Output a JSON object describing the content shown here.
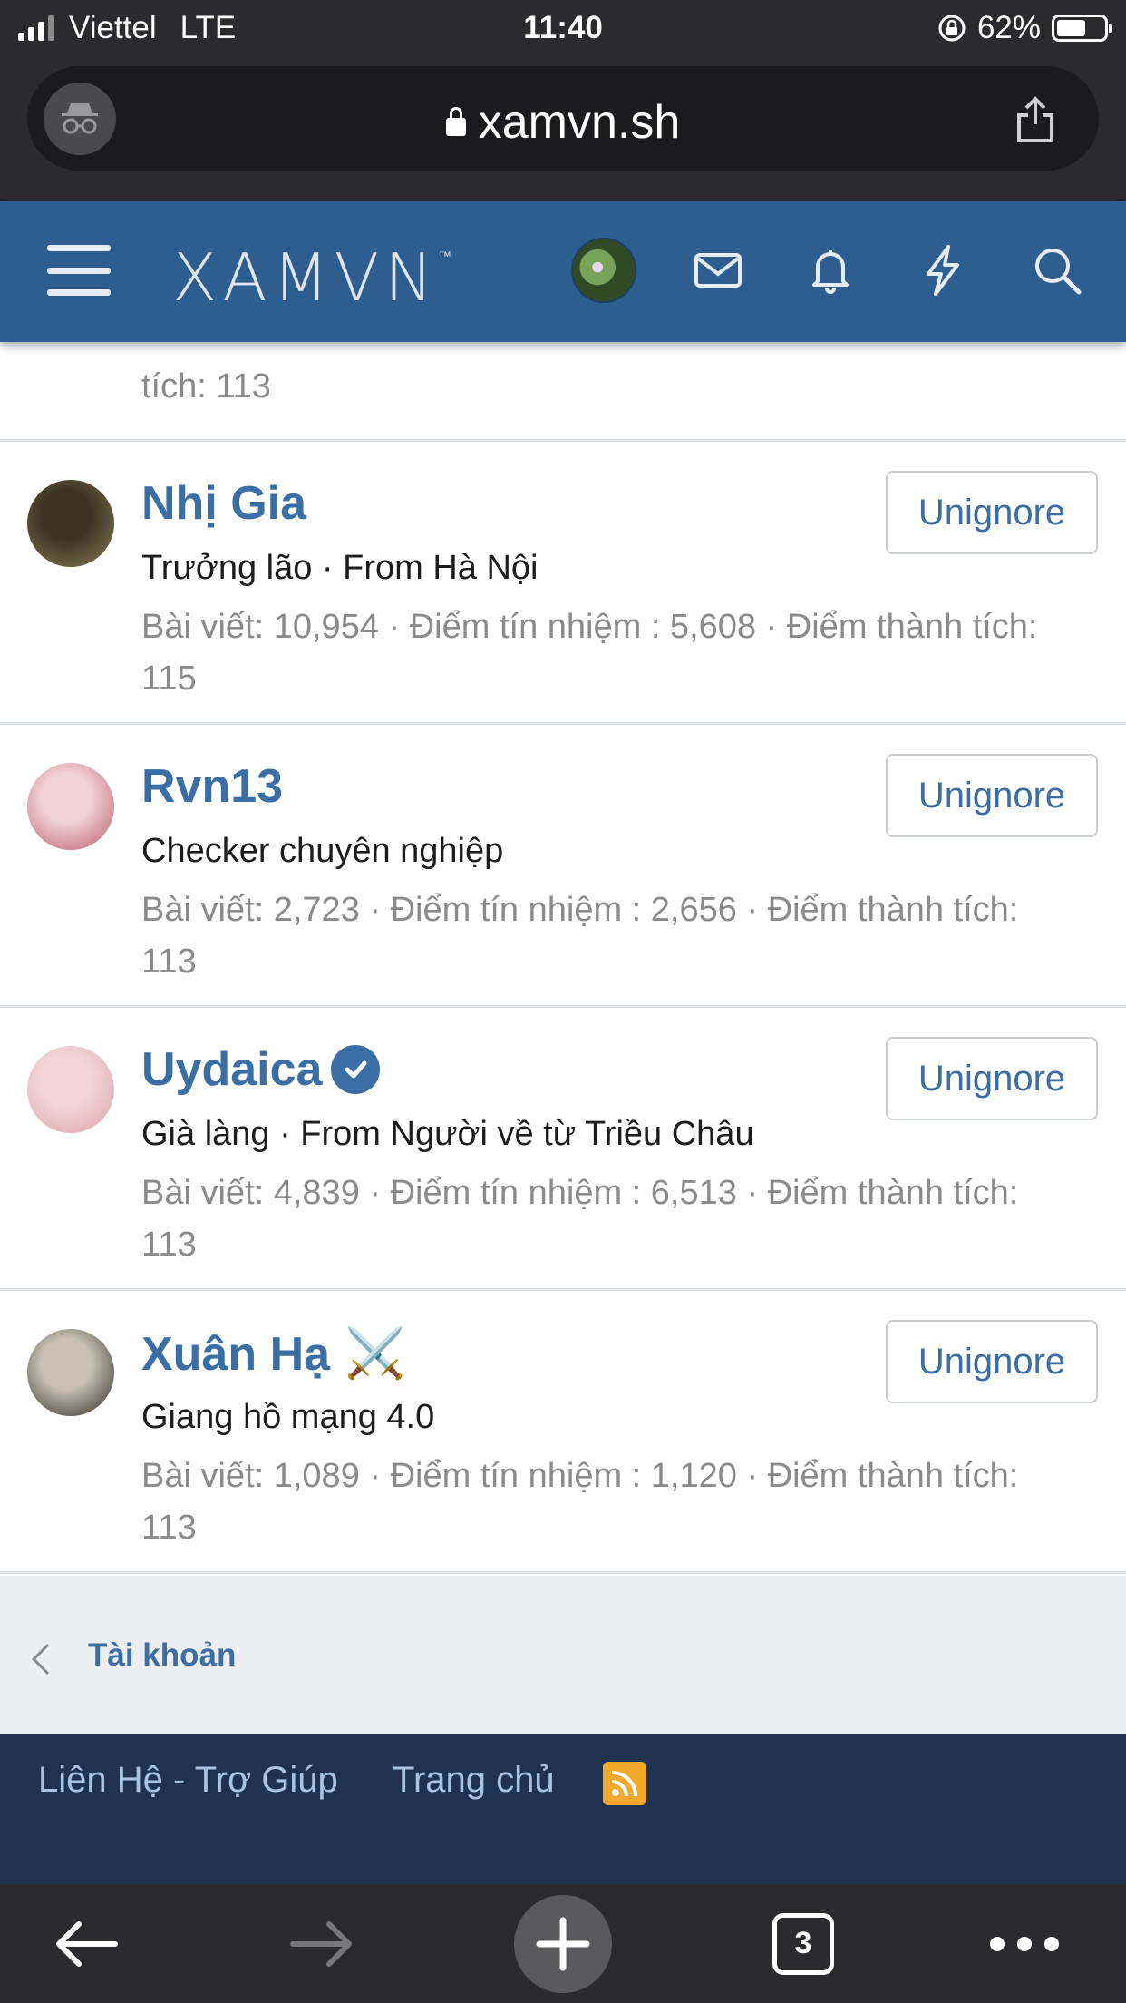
{
  "status_bar": {
    "carrier": "Viettel",
    "network": "LTE",
    "time": "11:40",
    "battery": "62%",
    "battery_level": 0.62
  },
  "browser": {
    "url": "xamvn.sh",
    "open_tabs": "3"
  },
  "header": {
    "logo_text": "XAMVN",
    "logo_mark": "™",
    "brand_color": "#2e5d8f"
  },
  "previous_member": {
    "stats_tail": "tích: 113"
  },
  "members": [
    {
      "name": "Nhị Gia",
      "title": "Trưởng lão · From Hà Nội",
      "stats": "Bài viết: 10,954 · Điểm tín nhiệm : 5,608 · Điểm thành tích: 115",
      "action": "Unignore",
      "badge": "",
      "avatar_colors": [
        "#3b3425",
        "#8a7b55"
      ]
    },
    {
      "name": "Rvn13",
      "title": "Checker chuyên nghiệp",
      "stats": "Bài viết: 2,723 · Điểm tín nhiệm : 2,656 · Điểm thành tích: 113",
      "action": "Unignore",
      "badge": "",
      "avatar_colors": [
        "#f1d2d5",
        "#b85a68"
      ]
    },
    {
      "name": "Uydaica",
      "title": "Già làng · From Người về từ Triều Châu",
      "stats": "Bài viết: 4,839 · Điểm tín nhiệm : 6,513 · Điểm thành tích: 113",
      "action": "Unignore",
      "badge": "verified",
      "avatar_colors": [
        "#f3d6d8",
        "#d9a3a8"
      ]
    },
    {
      "name": "Xuân Hạ",
      "title": "Giang hồ mạng 4.0",
      "stats": "Bài viết: 1,089 · Điểm tín nhiệm : 1,120 · Điểm thành tích: 113",
      "action": "Unignore",
      "badge": "⚔️",
      "avatar_colors": [
        "#c9c2b4",
        "#2a2520"
      ]
    }
  ],
  "breadcrumb": {
    "label": "Tài khoản"
  },
  "footer": {
    "contact": "Liên Hệ - Trợ Giúp",
    "home": "Trang chủ",
    "rss_icon": "rss-icon"
  }
}
